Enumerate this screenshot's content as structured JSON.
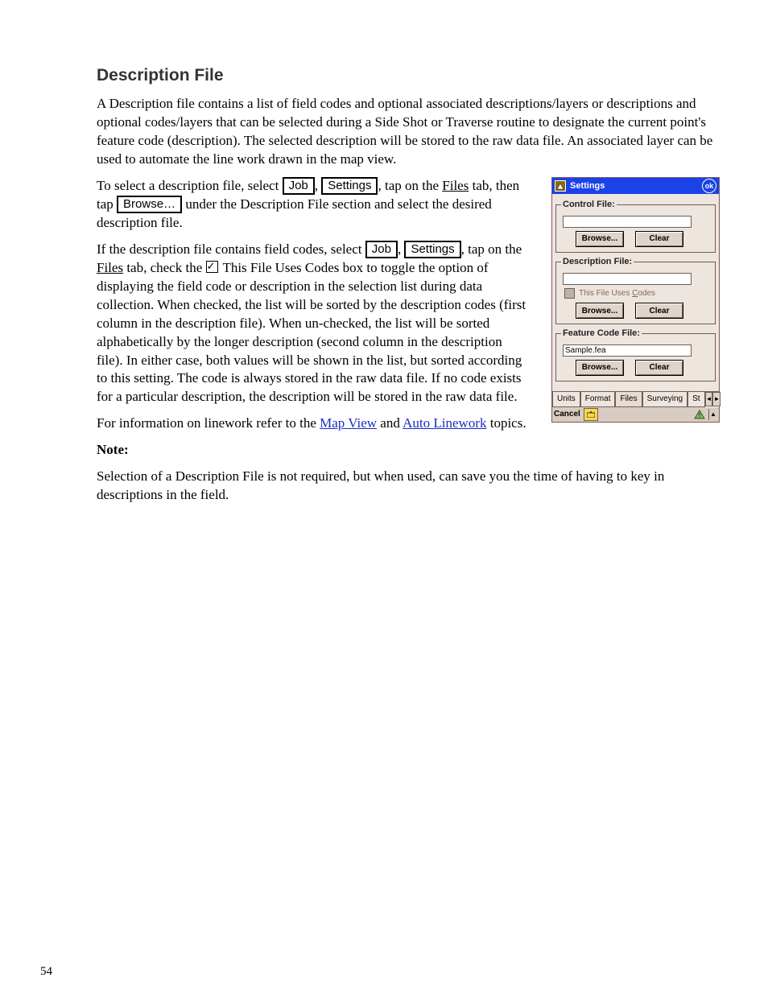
{
  "heading": "Description File",
  "paragraphs": {
    "intro": "A Description file contains a list of field codes and optional associated descriptions/layers or descriptions and optional codes/layers that can be selected during a Side Shot or Traverse routine to designate the current point's feature code (description). The selected description will be stored to the raw data file. An associated layer can be used to automate the line work drawn in the map view.",
    "step1a": "To select a description file, select ",
    "step1b": ", tap on the ",
    "step1c": " tab, then tap ",
    "step1d": " under the Description File section and select the desired description file.",
    "step2a": "If the description file contains field codes, select ",
    "step2b": ", tap on the ",
    "step2c": " tab, check the ",
    "step2d": " This File Uses Codes box to toggle the option of displaying the field code or description in the selection list during data collection. When checked, the list will be sorted by the description codes (first column in the description file). When un-checked, the list will be sorted alphabetically by the longer description (second column in the description file). In either case, both values will be shown in the list, but sorted according to this setting. The code is always stored in the raw data file. If no code exists for a particular description, the description will be stored in the raw data file.",
    "links_intro": "For information on linework refer to the ",
    "links_and": " and ",
    "links_end": " topics.",
    "note_body": "Selection of a Description File is not required, but when used, can save you the time of having to key in descriptions in the field."
  },
  "buttons": {
    "job": "Job",
    "settings": "Settings",
    "browse": "Browse…"
  },
  "tabs": {
    "files_underlined": "Files"
  },
  "links": {
    "mapview": "Map View",
    "autolinework": "Auto Linework"
  },
  "note_title": "Note:",
  "screenshot": {
    "title": "Settings",
    "ok": "ok",
    "groups": {
      "control": "Control File:",
      "description": "Description File:",
      "feature": "Feature Code File:"
    },
    "check_label_pre": "This File Uses ",
    "check_label_u": "C",
    "check_label_post": "odes",
    "feature_value": "Sample.fea",
    "btn_browse": "Browse...",
    "btn_clear": "Clear",
    "tabs": [
      "Units",
      "Format",
      "Files",
      "Surveying",
      "St"
    ],
    "selected_tab_index": 2,
    "status_cancel": "Cancel"
  },
  "page_number": "54"
}
